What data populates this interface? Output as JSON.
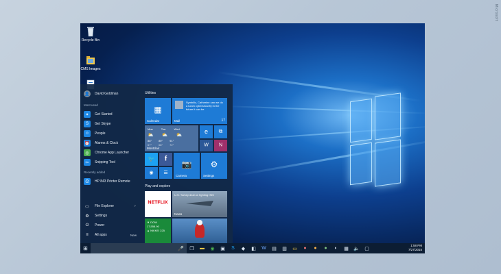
{
  "watermark": "Microsoft",
  "desktop": {
    "icons": [
      {
        "label": "Recycle Bin",
        "icon": "recycle-bin-icon"
      },
      {
        "label": "CMS Images",
        "icon": "folder-icon"
      }
    ]
  },
  "start_menu": {
    "user": "David Goldman",
    "most_used_label": "Most used",
    "most_used": [
      {
        "label": "Get Started",
        "icon": "lightbulb-icon",
        "color": "#1e88e5"
      },
      {
        "label": "Get Skype",
        "icon": "skype-icon",
        "color": "#1e88e5"
      },
      {
        "label": "People",
        "icon": "people-icon",
        "color": "#1e88e5"
      },
      {
        "label": "Alarms & Clock",
        "icon": "alarm-icon",
        "color": "#1e88e5"
      },
      {
        "label": "Chrome App Launcher",
        "icon": "chrome-icon",
        "color": "#4caf50"
      },
      {
        "label": "Snipping Tool",
        "icon": "scissors-icon",
        "color": "#1e88e5"
      }
    ],
    "recently_added_label": "Recently added",
    "recently_added": [
      {
        "label": "HP 843 Printer Remote",
        "icon": "printer-icon",
        "color": "#1e88e5"
      }
    ],
    "bottom": [
      {
        "label": "File Explorer",
        "icon": "folder-icon"
      },
      {
        "label": "Settings",
        "icon": "gear-icon"
      },
      {
        "label": "Power",
        "icon": "power-icon"
      },
      {
        "label": "All apps",
        "icon": "list-icon"
      }
    ],
    "new_label": "New"
  },
  "tiles": {
    "group1_label": "Utilities",
    "group2_label": "Play and explore",
    "calendar_label": "Calendar",
    "mail_label": "Mail",
    "mail_text": "Symbilic, Catherine can we do a lunch cybersecurity in the future it can be",
    "mail_count": "17",
    "weather": {
      "days": [
        "Mon",
        "Tue",
        "Wed"
      ],
      "temps": [
        "88°",
        "89°",
        "91°"
      ],
      "lows": [
        "67°",
        "68°",
        "72°"
      ],
      "city": "Montclair"
    },
    "camera_label": "Camera",
    "settings_label": "Settings",
    "netflix_label": "NETFLIX",
    "news_label": "News",
    "news_text": "U.S. Turkey deal on fighting ISIS",
    "money": {
      "lines": [
        "▼ DOW",
        "17,558.90",
        "▲ NIKKEI 225"
      ]
    }
  },
  "taskbar": {
    "time": "1:58 PM",
    "date": "7/27/2015"
  }
}
